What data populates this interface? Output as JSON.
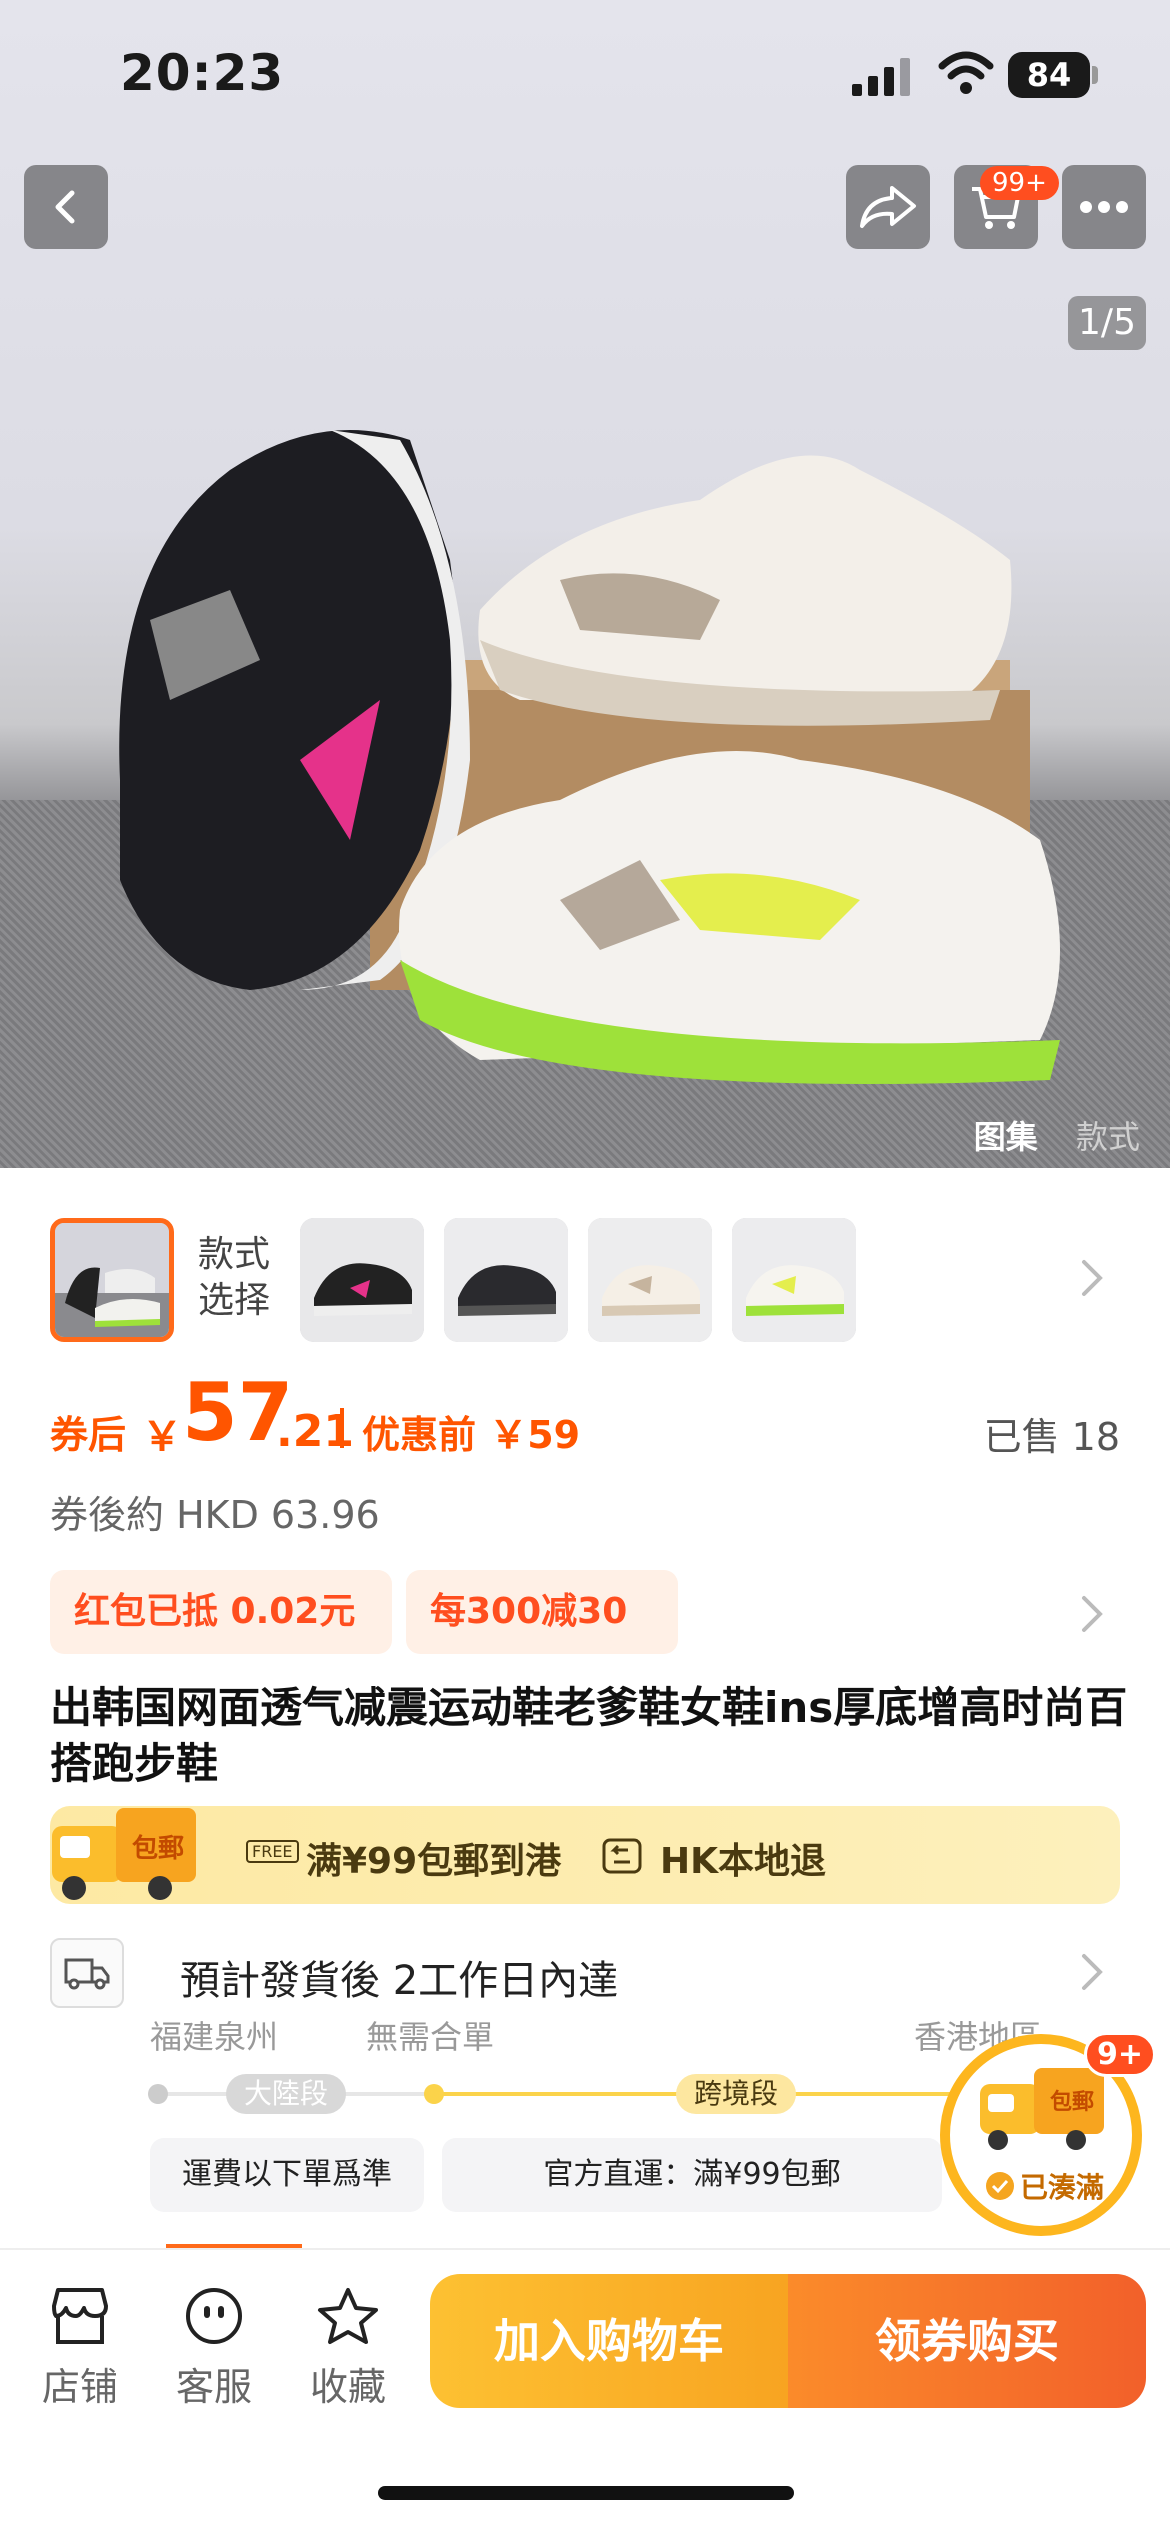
{
  "status_bar": {
    "time": "20:23",
    "battery": "84"
  },
  "header": {
    "cart_badge": "99+",
    "image_counter": "1/5"
  },
  "gallery_tabs": [
    "图集",
    "款式"
  ],
  "style_picker": {
    "label_line1": "款式",
    "label_line2": "选择"
  },
  "price": {
    "coupon_label": "券后",
    "currency": "￥",
    "integer": "57",
    "decimal": ".21",
    "original_label": "优惠前 ￥59",
    "sold": "已售 18",
    "hkd": "券後約 HKD 63.96"
  },
  "promos": {
    "red_packet": "红包已抵 0.02元",
    "discount": "每300减30"
  },
  "product_title": "出韩国网面透气减震运动鞋老爹鞋女鞋ins厚底增高时尚百搭跑步鞋",
  "shipping": {
    "truck_tag": "包郵",
    "free_tag": "FREE",
    "free_shipping": "满¥99包郵到港",
    "local_return": "HK本地退"
  },
  "delivery": {
    "estimate": "預計發貨後 2工作日內達",
    "from": "福建泉州",
    "consolidate": "無需合單",
    "to": "香港地區",
    "segment_mainland": "大陸段",
    "segment_cross": "跨境段",
    "note_mainland": "運費以下單爲準",
    "note_cross": "官方直運：滿¥99包郵"
  },
  "bubble": {
    "badge": "9+",
    "tag": "包郵",
    "status": "已湊滿"
  },
  "bottom_bar": {
    "shop": "店铺",
    "service": "客服",
    "favorite": "收藏",
    "add_to_cart": "加入购物车",
    "buy": "领券购买"
  },
  "colors": {
    "accent": "#ff5500",
    "yellow": "#fdc132",
    "orange": "#f2602a"
  }
}
